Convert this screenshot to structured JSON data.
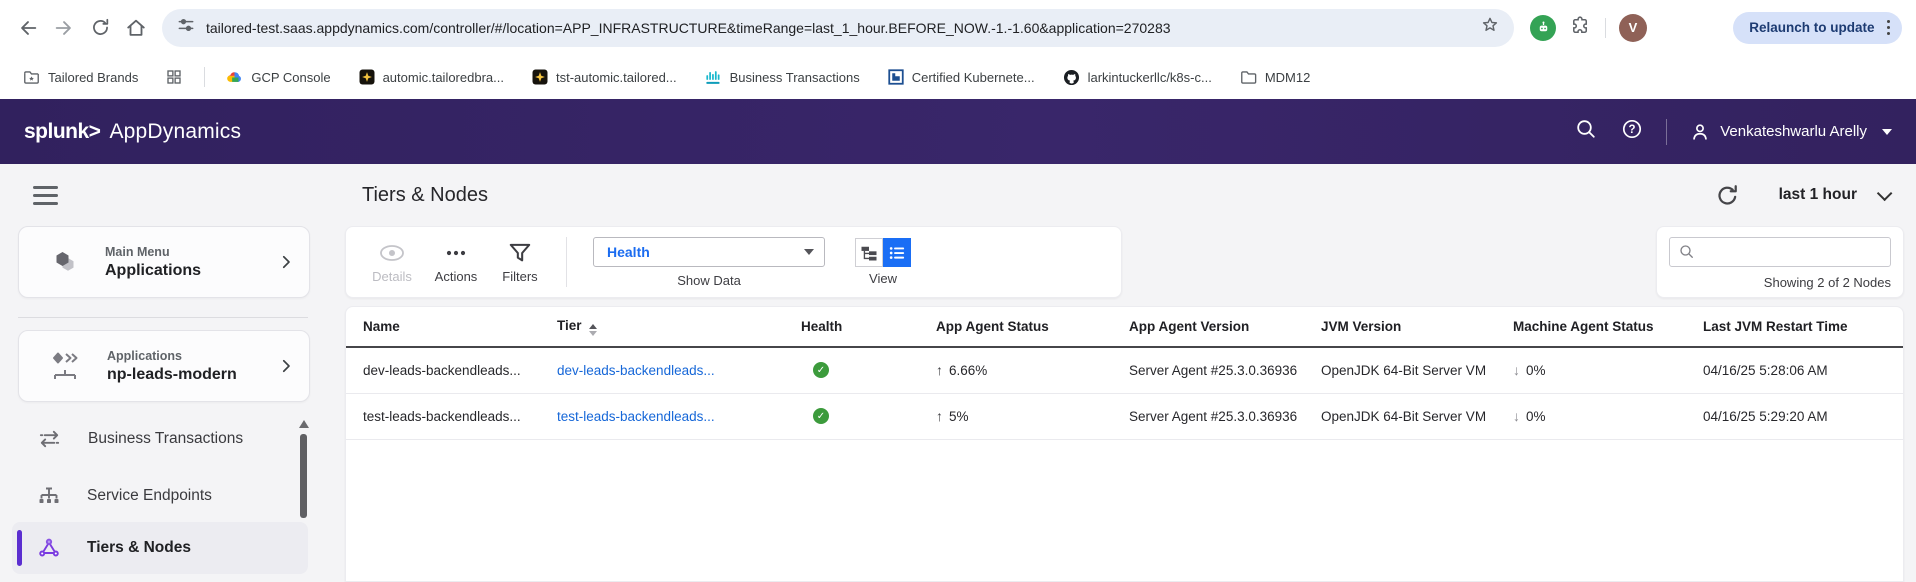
{
  "browser": {
    "toolbar": {
      "url": "tailored-test.saas.appdynamics.com/controller/#/location=APP_INFRASTRUCTURE&timeRange=last_1_hour.BEFORE_NOW.-1.-1.60&application=270283",
      "relaunch_label": "Relaunch to update",
      "avatar_letter": "V"
    },
    "bookmarks": {
      "items": [
        "Tailored Brands",
        "GCP Console",
        "automic.tailoredbra...",
        "tst-automic.tailored...",
        "Business Transactions",
        "Certified Kubernete...",
        "larkintuckerllc/k8s-c...",
        "MDM12"
      ]
    }
  },
  "appbar": {
    "brand_splunk": "splunk>",
    "brand_product": "AppDynamics",
    "user_name": "Venkateshwarlu Arelly"
  },
  "sidebar": {
    "main_menu_card": {
      "eyebrow": "Main Menu",
      "title": "Applications"
    },
    "app_card": {
      "eyebrow": "Applications",
      "title": "np-leads-modern"
    },
    "items": {
      "business_transactions": "Business Transactions",
      "service_endpoints": "Service Endpoints",
      "tiers_nodes": "Tiers & Nodes"
    }
  },
  "page": {
    "title": "Tiers & Nodes",
    "time_range": "last 1 hour"
  },
  "toolbar": {
    "details_label": "Details",
    "actions_label": "Actions",
    "filters_label": "Filters",
    "show_data_value": "Health",
    "show_data_label": "Show Data",
    "view_label": "View",
    "search_placeholder": "",
    "showing_text": "Showing 2 of 2 Nodes"
  },
  "table": {
    "columns": [
      "Name",
      "Tier",
      "Health",
      "App Agent Status",
      "App Agent Version",
      "JVM Version",
      "Machine Agent Status",
      "Last JVM Restart Time"
    ],
    "rows": [
      {
        "name": "dev-leads-backendleads...",
        "tier": "dev-leads-backendleads...",
        "health": "healthy",
        "app_agent_status": "6.66%",
        "app_agent_version": "Server Agent #25.3.0.36936",
        "jvm_version": "OpenJDK 64-Bit Server VM",
        "machine_agent_status": "0%",
        "last_jvm_restart": "04/16/25 5:28:06 AM"
      },
      {
        "name": "test-leads-backendleads...",
        "tier": "test-leads-backendleads...",
        "health": "healthy",
        "app_agent_status": "5%",
        "app_agent_version": "Server Agent #25.3.0.36936",
        "jvm_version": "OpenJDK 64-Bit Server VM",
        "machine_agent_status": "0%",
        "last_jvm_restart": "04/16/25 5:29:20 AM"
      }
    ]
  },
  "colors": {
    "header_purple": "#342465",
    "accent_blue": "#1a6ef5",
    "link_blue": "#1667d8",
    "health_green": "#3c9b3c",
    "selected_purple": "#5b2ed0"
  }
}
